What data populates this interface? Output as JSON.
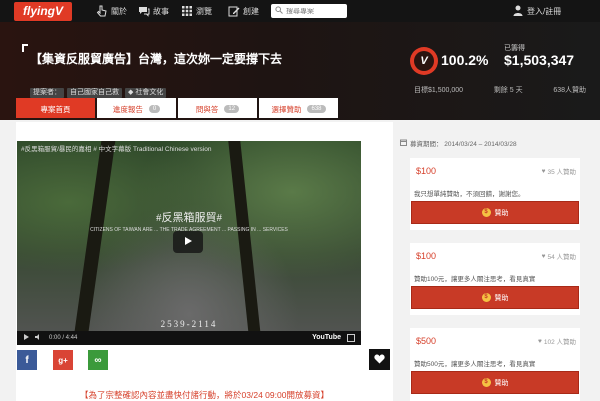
{
  "nav": {
    "logo": "flyingV",
    "items": [
      {
        "label": "關於",
        "icon": "pointer-icon"
      },
      {
        "label": "故事",
        "icon": "chat-icon"
      },
      {
        "label": "瀏覽",
        "icon": "grid-icon"
      },
      {
        "label": "創建",
        "icon": "edit-icon"
      }
    ],
    "search_placeholder": "搜尋專案",
    "login_label": "登入/註冊"
  },
  "project": {
    "title": "【集資反服貿廣告】台灣，這次妳一定要撐下去",
    "proposer_label": "提案者：",
    "proposer": "自己國家自己救",
    "category": "社會文化",
    "percent": "100.2%",
    "raised_label": "已籌得",
    "raised": "$1,503,347",
    "goal": "目標$1,500,000",
    "days_left": "剩餘 5 天",
    "backers": "638人贊助"
  },
  "tabs": [
    {
      "label": "專案首頁",
      "badge": ""
    },
    {
      "label": "進度報告",
      "badge": "0"
    },
    {
      "label": "問與答",
      "badge": "12"
    },
    {
      "label": "選擇贊助",
      "badge": "638"
    }
  ],
  "video": {
    "title": "#反黑箱服貿/暴民的嘉相 # 中文字幕版 Traditional Chinese version",
    "overlay_main": "#反黑箱服貿#",
    "overlay_sub": "CITIZENS OF TAIWAN ARE ... THE TRADE AGREEMENT ... PASSING IN ... SERVICES",
    "overlay_date": "2539-2114",
    "time": "0:00 / 4:44",
    "yt": "YouTube"
  },
  "share": [
    {
      "label": "f",
      "color": "#3b5a98"
    },
    {
      "label": "g+",
      "color": "#d94435"
    },
    {
      "label": "∞",
      "color": "#3b9a3b"
    }
  ],
  "notice": "【為了宗整確認內容並盡快付諸行動，將於03/24 09:00開放募資】",
  "sidebar": {
    "period": "募資期間：  2014/03/24 – 2014/03/28",
    "rewards": [
      {
        "amount": "$100",
        "backers": "35 人贊助",
        "desc": "我只想單純贊助，不須回饋，謝謝您。",
        "button": "贊助"
      },
      {
        "amount": "$100",
        "backers": "54 人贊助",
        "desc": "贊助100元，讓更多人關注思考，看見真實",
        "button": "贊助"
      },
      {
        "amount": "$500",
        "backers": "102 人贊助",
        "desc": "贊助500元，讓更多人關注思考，看見真實",
        "button": "贊助"
      }
    ]
  },
  "colors": {
    "brand": "#e03a25",
    "button": "#c83a26",
    "nav_bg": "#141414"
  }
}
